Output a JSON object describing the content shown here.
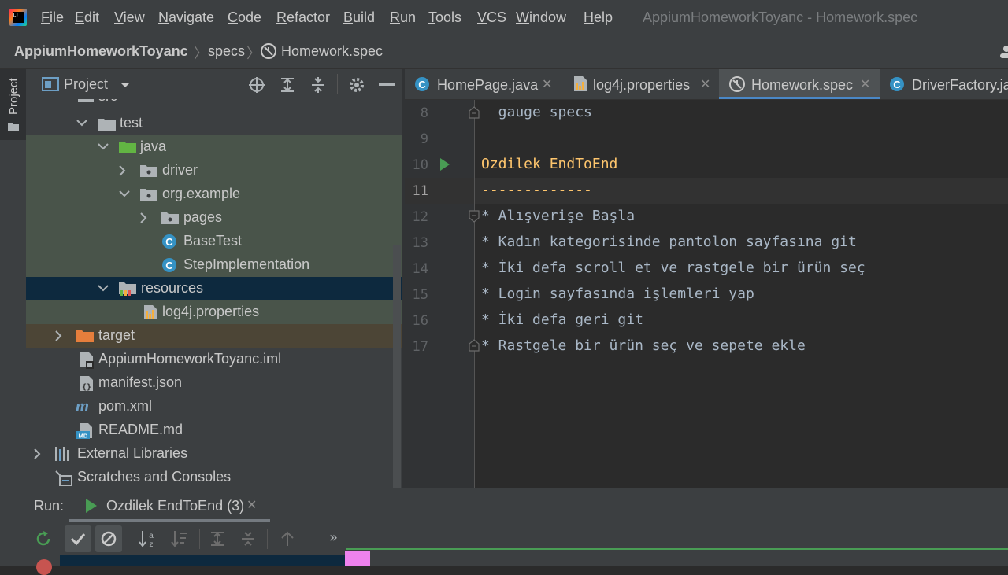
{
  "menu": {
    "items": [
      {
        "label": "File",
        "ul": "F",
        "rest": "ile"
      },
      {
        "label": "Edit",
        "ul": "E",
        "rest": "dit"
      },
      {
        "label": "View",
        "ul": "V",
        "rest": "iew"
      },
      {
        "label": "Navigate",
        "ul": "N",
        "rest": "avigate"
      },
      {
        "label": "Code",
        "ul": "C",
        "rest": "ode"
      },
      {
        "label": "Refactor",
        "ul": "R",
        "rest": "efactor"
      },
      {
        "label": "Build",
        "ul": "B",
        "rest": "uild"
      },
      {
        "label": "Run",
        "ul": "R",
        "rest": "un"
      },
      {
        "label": "Tools",
        "ul": "T",
        "rest": "ools"
      },
      {
        "label": "VCS",
        "ul": "V",
        "rest": "CS"
      },
      {
        "label": "Window",
        "ul": "W",
        "rest": "indow"
      },
      {
        "label": "Help",
        "ul": "H",
        "rest": "elp"
      }
    ],
    "window_title": "AppiumHomeworkToyanc - Homework.spec",
    "logo_text": "IJ"
  },
  "breadcrumb": {
    "project": "AppiumHomeworkToyanc",
    "folder": "specs",
    "file": "Homework.spec"
  },
  "sidebar": {
    "strip_label": "Project",
    "panel_title": "Project",
    "tree": [
      {
        "label": "src"
      },
      {
        "label": "test"
      },
      {
        "label": "java"
      },
      {
        "label": "driver"
      },
      {
        "label": "org.example"
      },
      {
        "label": "pages"
      },
      {
        "label": "BaseTest"
      },
      {
        "label": "StepImplementation"
      },
      {
        "label": "resources"
      },
      {
        "label": "log4j.properties"
      },
      {
        "label": "target"
      },
      {
        "label": "AppiumHomeworkToyanc.iml"
      },
      {
        "label": "manifest.json"
      },
      {
        "label": "pom.xml"
      },
      {
        "label": "README.md"
      },
      {
        "label": "External Libraries"
      },
      {
        "label": "Scratches and Consoles"
      }
    ]
  },
  "tabs": [
    {
      "label": "HomePage.java"
    },
    {
      "label": "log4j.properties"
    },
    {
      "label": "Homework.spec"
    },
    {
      "label": "DriverFactory.ja"
    }
  ],
  "editor": {
    "lines": [
      {
        "num": "8",
        "text": "  gauge specs"
      },
      {
        "num": "9",
        "text": ""
      },
      {
        "num": "10",
        "text": "Ozdilek EndToEnd"
      },
      {
        "num": "11",
        "text": "-------------"
      },
      {
        "num": "12",
        "text": "* Alışverişe Başla"
      },
      {
        "num": "13",
        "text": "* Kadın kategorisinde pantolon sayfasına git"
      },
      {
        "num": "14",
        "text": "* İki defa scroll et ve rastgele bir ürün seç"
      },
      {
        "num": "15",
        "text": "* Login sayfasında işlemleri yap"
      },
      {
        "num": "16",
        "text": "* İki defa geri git"
      },
      {
        "num": "17",
        "text": "* Rastgele bir ürün seç ve sepete ekle"
      }
    ]
  },
  "run": {
    "label": "Run:",
    "tab": "Ozdilek EndToEnd (3)",
    "overflow": "»"
  },
  "colors": {
    "accent": "#4a88c7",
    "spec_header": "#ffc66d",
    "run_green": "#499c54"
  }
}
